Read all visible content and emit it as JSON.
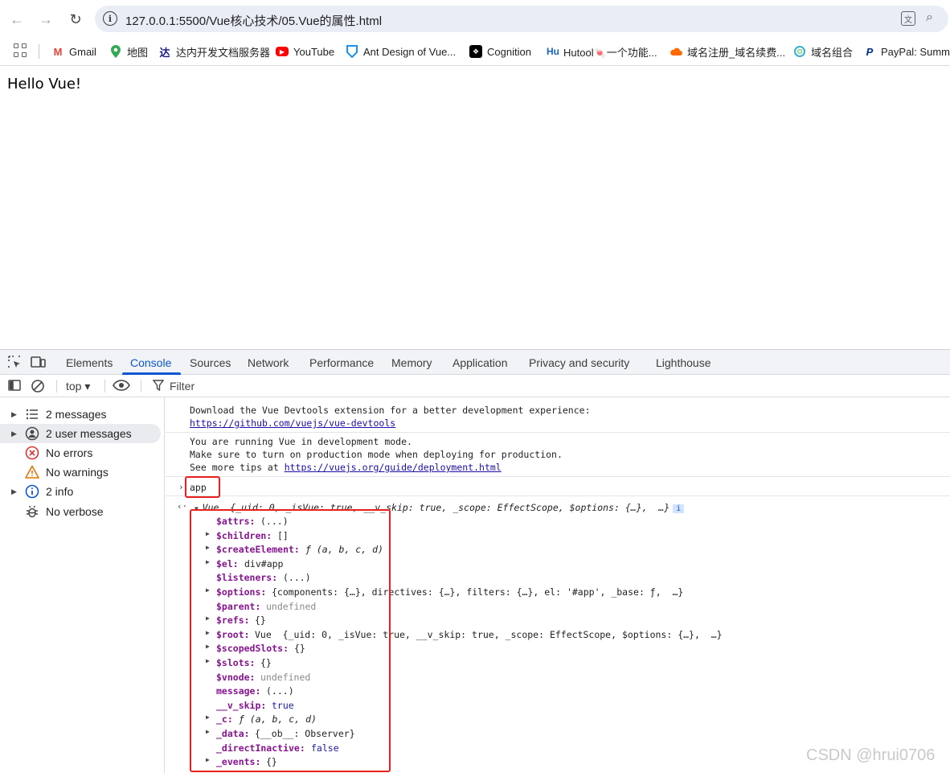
{
  "browser": {
    "url": "127.0.0.1:5500/Vue核心技术/05.Vue的属性.html",
    "bookmarks": [
      {
        "label": "Gmail",
        "icon": "gmail-icon",
        "color": "#ea4335"
      },
      {
        "label": "地图",
        "icon": "maps-pin-icon",
        "color": "#34a853"
      },
      {
        "label": "达内开发文档服务器",
        "icon": "tarena-icon",
        "color": "#1a1a8a"
      },
      {
        "label": "YouTube",
        "icon": "youtube-icon",
        "color": "#ff0000"
      },
      {
        "label": "Ant Design of Vue...",
        "icon": "ant-design-icon",
        "color": "#1890ff"
      },
      {
        "label": "Cognition",
        "icon": "cognition-icon",
        "color": "#000000"
      },
      {
        "label": "Hutool🍬一个功能...",
        "icon": "hutool-icon",
        "color": "#1565c0"
      },
      {
        "label": "域名注册_域名续费...",
        "icon": "cloud-icon",
        "color": "#ff6a00"
      },
      {
        "label": "域名组合",
        "icon": "swirl-icon",
        "color": "#3ab0c8"
      },
      {
        "label": "PayPal: Summa",
        "icon": "paypal-icon",
        "color": "#003087"
      }
    ]
  },
  "page": {
    "text": "Hello Vue!"
  },
  "devtools": {
    "tabs": [
      "Elements",
      "Console",
      "Sources",
      "Network",
      "Performance",
      "Memory",
      "Application",
      "Privacy and security",
      "Lighthouse"
    ],
    "active_tab": "Console",
    "context": "top ▾",
    "filter_placeholder": "Filter",
    "sidebar": [
      {
        "label": "2 messages",
        "icon": "list-icon",
        "expandable": true
      },
      {
        "label": "2 user messages",
        "icon": "user-icon",
        "expandable": true
      },
      {
        "label": "No errors",
        "icon": "error-icon",
        "expandable": false
      },
      {
        "label": "No warnings",
        "icon": "warning-icon",
        "expandable": false
      },
      {
        "label": "2 info",
        "icon": "info-icon",
        "expandable": true
      },
      {
        "label": "No verbose",
        "icon": "bug-icon",
        "expandable": false
      }
    ],
    "console": {
      "msg1_line1": "Download the Vue Devtools extension for a better development experience:",
      "msg1_link": "https://github.com/vuejs/vue-devtools",
      "msg2_line1": "You are running Vue in development mode.",
      "msg2_line2": "Make sure to turn on production mode when deploying for production.",
      "msg2_line3_prefix": "See more tips at ",
      "msg2_link": "https://vuejs.org/guide/deployment.html",
      "input": "app",
      "result_header": "Vue  {_uid: 0, _isVue: true, __v_skip: true, _scope: EffectScope, $options: {…},  …}",
      "info_badge": "i",
      "properties": [
        {
          "key": "$attrs",
          "value": "(...)",
          "expandable": false
        },
        {
          "key": "$children",
          "value": "[]",
          "expandable": true
        },
        {
          "key": "$createElement",
          "value": "ƒ (a, b, c, d)",
          "expandable": true
        },
        {
          "key": "$el",
          "value": "div#app",
          "expandable": true
        },
        {
          "key": "$listeners",
          "value": "(...)",
          "expandable": false
        },
        {
          "key": "$options",
          "value": "{components: {…}, directives: {…}, filters: {…}, el: '#app', _base: ƒ,  …}",
          "expandable": true
        },
        {
          "key": "$parent",
          "value": "undefined",
          "expandable": false
        },
        {
          "key": "$refs",
          "value": "{}",
          "expandable": true
        },
        {
          "key": "$root",
          "value": "Vue  {_uid: 0, _isVue: true, __v_skip: true, _scope: EffectScope, $options: {…},  …}",
          "expandable": true
        },
        {
          "key": "$scopedSlots",
          "value": "{}",
          "expandable": true
        },
        {
          "key": "$slots",
          "value": "{}",
          "expandable": true
        },
        {
          "key": "$vnode",
          "value": "undefined",
          "expandable": false
        },
        {
          "key": "message",
          "value": "(...)",
          "expandable": false
        },
        {
          "key": "__v_skip",
          "value": "true",
          "expandable": false
        },
        {
          "key": "_c",
          "value": "ƒ (a, b, c, d)",
          "expandable": true
        },
        {
          "key": "_data",
          "value": "{__ob__: Observer}",
          "expandable": true
        },
        {
          "key": "_directInactive",
          "value": "false",
          "expandable": false
        },
        {
          "key": "_events",
          "value": "{}",
          "expandable": true
        }
      ]
    }
  },
  "watermark": "CSDN @hrui0706",
  "colors": {
    "accent": "#0b57d0",
    "highlight_box": "#e8201d",
    "property_key": "#881391"
  }
}
